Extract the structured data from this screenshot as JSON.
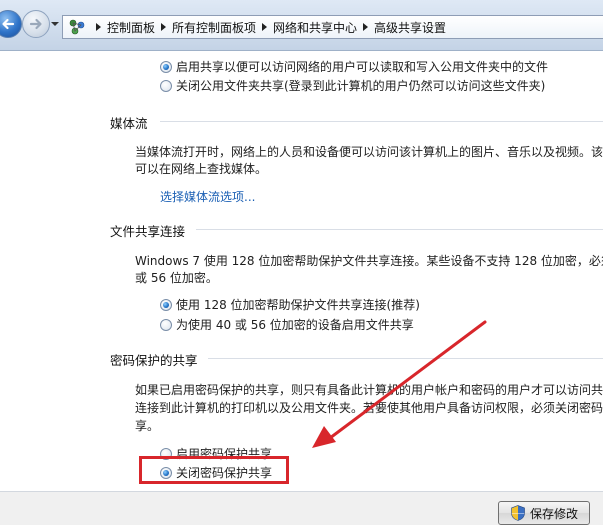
{
  "breadcrumb": {
    "items": [
      "控制面板",
      "所有控制面板项",
      "网络和共享中心",
      "高级共享设置"
    ]
  },
  "public_folder": {
    "options": [
      {
        "label": "启用共享以便可以访问网络的用户可以读取和写入公用文件夹中的文件",
        "selected": true
      },
      {
        "label": "关闭公用文件夹共享(登录到此计算机的用户仍然可以访问这些文件夹)",
        "selected": false
      }
    ]
  },
  "media": {
    "title": "媒体流",
    "desc_line1": "当媒体流打开时，网络上的人员和设备便可以访问该计算机上的图片、音乐以及视频。该",
    "desc_line2": "可以在网络上查找媒体。",
    "link": "选择媒体流选项..."
  },
  "file_sharing": {
    "title": "文件共享连接",
    "desc_line1": "Windows 7 使用 128 位加密帮助保护文件共享连接。某些设备不支持 128 位加密，必须",
    "desc_line2": "或 56 位加密。",
    "options": [
      {
        "label": "使用 128 位加密帮助保护文件共享连接(推荐)",
        "selected": true
      },
      {
        "label": "为使用 40 或 56 位加密的设备启用文件共享",
        "selected": false
      }
    ]
  },
  "password": {
    "title": "密码保护的共享",
    "desc_line1": "如果已启用密码保护的共享，则只有具备此计算机的用户帐户和密码的用户才可以访问共",
    "desc_line2": "连接到此计算机的打印机以及公用文件夹。若要使其他用户具备访问权限，必须关闭密码",
    "desc_line3": "享。",
    "options": [
      {
        "label": "启用密码保护共享",
        "selected": false
      },
      {
        "label": "关闭密码保护共享",
        "selected": true
      }
    ]
  },
  "footer": {
    "save_label": "保存修改"
  },
  "colors": {
    "annotation": "#d8262b",
    "link": "#1a5fb4"
  }
}
